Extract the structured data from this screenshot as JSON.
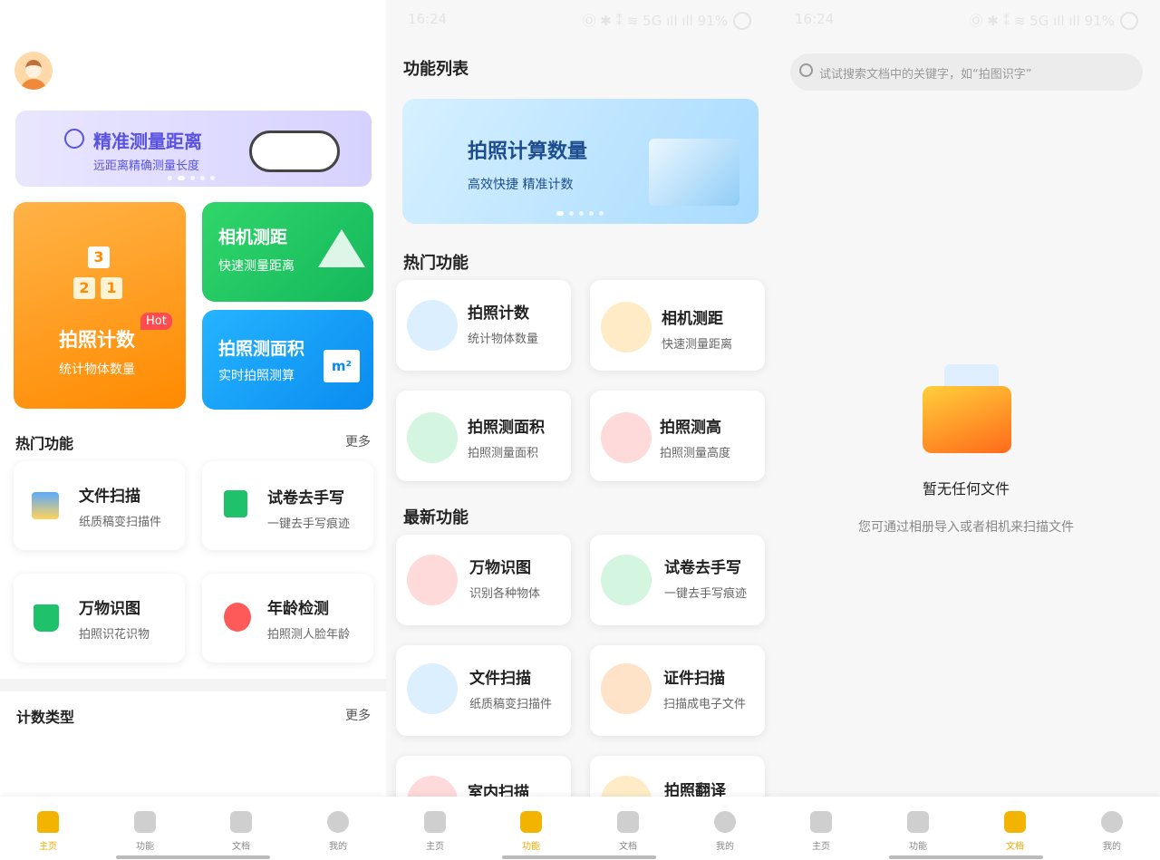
{
  "status_bar": {
    "time": "16:24",
    "right": "Ⓞ ✱ ⁑ ≋ 5G ıll ıll 91%"
  },
  "home": {
    "banner": {
      "title": "精准测量距离",
      "subtitle": "远距离精确测量长度"
    },
    "big_card": {
      "title": "拍照计数",
      "subtitle": "统计物体数量",
      "badge": "Hot",
      "num3": "3",
      "num2": "2",
      "num1": "1"
    },
    "card_distance": {
      "title": "相机测距",
      "subtitle": "快速测量距离"
    },
    "card_area": {
      "title": "拍照测面积",
      "subtitle": "实时拍照测算",
      "unit": "m²"
    },
    "hot_section": {
      "title": "热门功能",
      "more": "更多"
    },
    "hot_items": [
      {
        "title": "文件扫描",
        "subtitle": "纸质稿变扫描件"
      },
      {
        "title": "试卷去手写",
        "subtitle": "一键去手写痕迹"
      },
      {
        "title": "万物识图",
        "subtitle": "拍照识花识物"
      },
      {
        "title": "年龄检测",
        "subtitle": "拍照测人脸年龄"
      }
    ],
    "count_section": {
      "title": "计数类型",
      "more": "更多"
    }
  },
  "features": {
    "page_title": "功能列表",
    "banner": {
      "title": "拍照计算数量",
      "subtitle": "高效快捷 精准计数"
    },
    "hot_title": "热门功能",
    "hot_items": [
      {
        "title": "拍照计数",
        "subtitle": "统计物体数量"
      },
      {
        "title": "相机测距",
        "subtitle": "快速测量距离"
      },
      {
        "title": "拍照测面积",
        "subtitle": "拍照测量面积"
      },
      {
        "title": "拍照测高",
        "subtitle": "拍照测量高度"
      }
    ],
    "new_title": "最新功能",
    "new_items": [
      {
        "title": "万物识图",
        "subtitle": "识别各种物体"
      },
      {
        "title": "试卷去手写",
        "subtitle": "一键去手写痕迹"
      },
      {
        "title": "文件扫描",
        "subtitle": "纸质稿变扫描件"
      },
      {
        "title": "证件扫描",
        "subtitle": "扫描成电子文件"
      },
      {
        "title": "室内扫描",
        "subtitle": ""
      },
      {
        "title": "拍照翻译",
        "subtitle": ""
      }
    ]
  },
  "docs": {
    "search_placeholder": "试试搜索文档中的关键字，如“拍图识字”",
    "empty_title": "暂无任何文件",
    "empty_desc": "您可通过相册导入或者相机来扫描文件"
  },
  "tabs": [
    "主页",
    "功能",
    "文档",
    "我的"
  ],
  "colors": {
    "accent": "#f2a900",
    "orange": "#ff9a1a",
    "green": "#22c55e",
    "blue": "#1aa3ff"
  }
}
